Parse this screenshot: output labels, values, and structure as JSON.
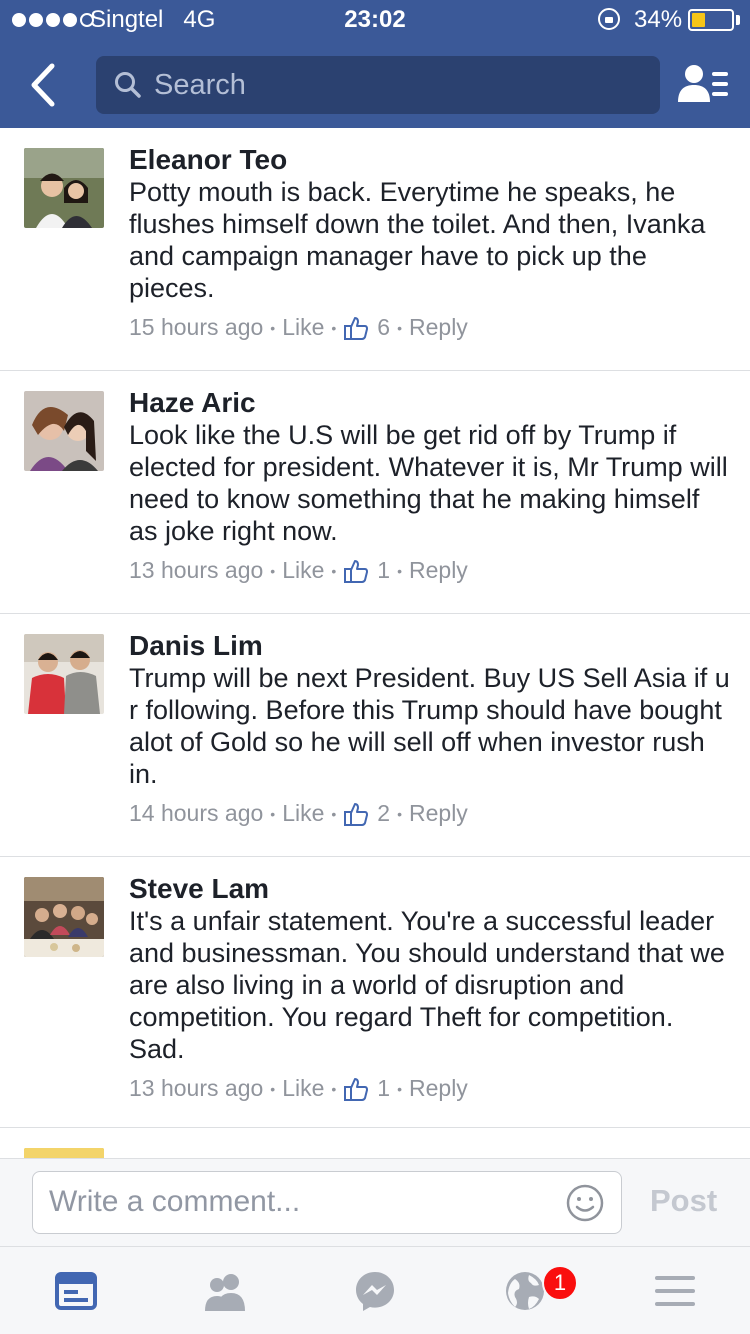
{
  "status_bar": {
    "carrier": "Singtel",
    "network": "4G",
    "time": "23:02",
    "battery": "34%",
    "battery_level": 0.34,
    "signal_bars": 4,
    "icons": [
      "rotation-lock-icon",
      "battery-icon"
    ]
  },
  "nav": {
    "search_placeholder": "Search",
    "icons": [
      "back-chevron-icon",
      "search-icon",
      "friends-list-icon"
    ]
  },
  "comments": [
    {
      "name": "Eleanor Teo",
      "text": "Potty mouth is back. Everytime he speaks, he flushes himself down the toilet. And then, Ivanka and campaign manager have to pick up the pieces.",
      "time": "15 hours ago",
      "like_label": "Like",
      "like_count": "6",
      "reply_label": "Reply"
    },
    {
      "name": "Haze Aric",
      "text": "Look like the U.S will be get rid off by Trump if elected for president. Whatever it is, Mr Trump will need to know something that he making himself as joke right now.",
      "time": "13 hours ago",
      "like_label": "Like",
      "like_count": "1",
      "reply_label": "Reply"
    },
    {
      "name": "Danis Lim",
      "text": "Trump will be next President. Buy US Sell Asia if u r following. Before this Trump should have bought alot of Gold so he will sell off when investor rush in.",
      "time": "14 hours ago",
      "like_label": "Like",
      "like_count": "2",
      "reply_label": "Reply"
    },
    {
      "name": "Steve Lam",
      "text": "It's a unfair statement. You're a successful leader and businessman. You should understand that we are also living in a world of disruption and competition. You regard Theft for competition. Sad.",
      "time": "13 hours ago",
      "like_label": "Like",
      "like_count": "1",
      "reply_label": "Reply"
    }
  ],
  "composer": {
    "placeholder": "Write a comment...",
    "post_label": "Post",
    "icons": [
      "smiley-icon"
    ]
  },
  "tab_bar": {
    "tabs": [
      "news-feed-icon",
      "friend-requests-icon",
      "messenger-icon",
      "notifications-globe-icon",
      "menu-icon"
    ],
    "active_tab": "news-feed-icon",
    "notification_badge": "1"
  },
  "colors": {
    "brand": "#3b5998",
    "search_field": "#2b4170",
    "link_gray": "#90949c",
    "text": "#1d2129",
    "badge": "#fa0e0e"
  }
}
